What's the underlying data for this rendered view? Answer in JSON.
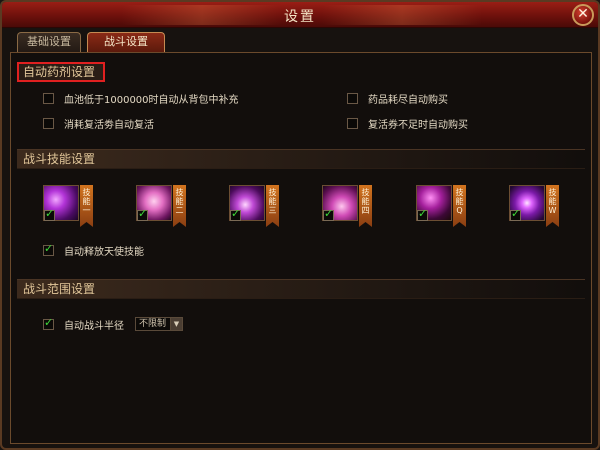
{
  "window": {
    "title": "设置",
    "close_symbol": "✕"
  },
  "tabs": [
    {
      "label": "基础设置",
      "active": false
    },
    {
      "label": "战斗设置",
      "active": true
    }
  ],
  "potion_section": {
    "title": "自动药剂设置",
    "options": [
      {
        "label": "血池低于1000000时自动从背包中补充",
        "checked": false
      },
      {
        "label": "药品耗尽自动购买",
        "checked": false
      },
      {
        "label": "消耗复活劵自动复活",
        "checked": false
      },
      {
        "label": "复活券不足时自动购买",
        "checked": false
      }
    ]
  },
  "skill_section": {
    "title": "战斗技能设置",
    "skills": [
      {
        "ribbon": "技\n能\n一",
        "icon": "lightning-claw-skill-icon",
        "checked": true
      },
      {
        "ribbon": "技\n能\n二",
        "icon": "rose-skill-icon",
        "checked": true
      },
      {
        "ribbon": "技\n能\n三",
        "icon": "fairy-skill-icon",
        "checked": true
      },
      {
        "ribbon": "技\n能\n四",
        "icon": "slash-skill-icon",
        "checked": true
      },
      {
        "ribbon": "技\n能\nQ",
        "icon": "blade-skill-icon",
        "checked": true
      },
      {
        "ribbon": "技\n能\nW",
        "icon": "burst-skill-icon",
        "checked": true
      }
    ],
    "auto_angel": {
      "label": "自动释放天使技能",
      "checked": true
    }
  },
  "range_section": {
    "title": "战斗范围设置",
    "auto_radius": {
      "label": "自动战斗半径",
      "checked": true
    },
    "radius_select": {
      "value": "不限制"
    }
  },
  "colors": {
    "title_red": "#9a1e15",
    "highlight_border": "#e02020",
    "check_green": "#3fd93a",
    "ribbon_orange": "#d2741f"
  }
}
